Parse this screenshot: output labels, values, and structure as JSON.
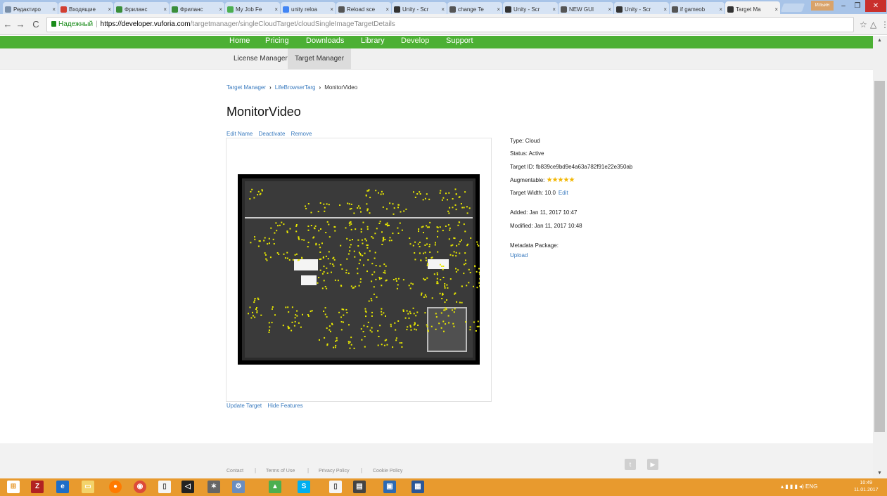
{
  "browser": {
    "tabs": [
      {
        "label": "Редактиро",
        "color": "#7a8fa8"
      },
      {
        "label": "Входящие",
        "color": "#d23f31"
      },
      {
        "label": "Фриланс",
        "color": "#3a8e3a"
      },
      {
        "label": "Фриланс",
        "color": "#3a8e3a"
      },
      {
        "label": "My Job Fe",
        "color": "#4caf50"
      },
      {
        "label": "unity reloa",
        "color": "#4285f4"
      },
      {
        "label": "Reload sce",
        "color": "#555555"
      },
      {
        "label": "Unity - Scr",
        "color": "#333333"
      },
      {
        "label": "change Te",
        "color": "#555555"
      },
      {
        "label": "Unity - Scr",
        "color": "#333333"
      },
      {
        "label": "NEW GUI",
        "color": "#555555"
      },
      {
        "label": "Unity - Scr",
        "color": "#333333"
      },
      {
        "label": "if gameob",
        "color": "#555555"
      },
      {
        "label": "Target Ma",
        "color": "#333333",
        "active": true
      }
    ],
    "user_badge": "Ильин",
    "secure_label": "Надежный",
    "url_host": "https://developer.vuforia.com",
    "url_path": "/targetmanager/singleCloudTarget/cloudSingleImageTargetDetails"
  },
  "topnav": {
    "items": [
      "Home",
      "Pricing",
      "Downloads",
      "Library",
      "Develop",
      "Support"
    ]
  },
  "subnav": {
    "tabs": [
      "License Manager",
      "Target Manager"
    ]
  },
  "breadcrumb": {
    "items": [
      "Target Manager",
      "LifeBrowserTarg",
      "MonitorVideo"
    ]
  },
  "target": {
    "name": "MonitorVideo",
    "actions": [
      "Edit Name",
      "Deactivate",
      "Remove"
    ],
    "bottom_actions": [
      "Update Target",
      "Hide Features"
    ],
    "type": "Type: Cloud",
    "status": "Status: Active",
    "target_id": "Target ID: fb839ce9bd9e4a63a782f91e22e350ab",
    "augmentable_label": "Augmentable:",
    "augmentable_rating": 5,
    "stars": "★★★★★",
    "width": "Target Width: 10.0",
    "width_edit": "Edit",
    "added": "Added: Jan 11, 2017 10:47",
    "modified": "Modified: Jan 11, 2017 10:48",
    "metadata_label": "Metadata Package:",
    "metadata_upload": "Upload"
  },
  "footer": {
    "links": [
      "Contact",
      "Terms of Use",
      "Privacy Policy",
      "Cookie Policy"
    ],
    "separator": "|"
  },
  "taskbar": {
    "language": "ENG",
    "time": "10:49",
    "date": "11.01.2017"
  },
  "colors": {
    "nav_green": "#4cb034",
    "link_blue": "#3a7bbf",
    "star_gold": "#f2b705",
    "taskbar_orange": "#e89a2e",
    "feature_yellow": "#e8e800"
  }
}
